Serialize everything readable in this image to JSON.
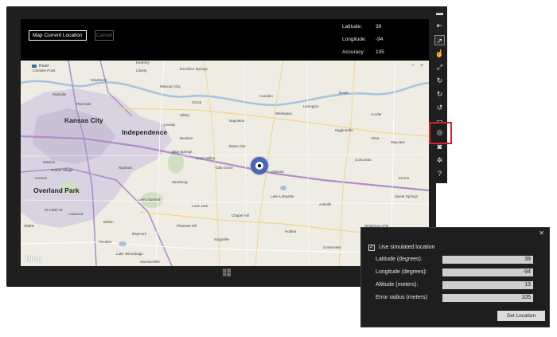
{
  "app": {
    "map_location_button": "Map Current Location",
    "cancel_button": "Cancel",
    "readouts": [
      {
        "label": "Latitude:",
        "value": "39"
      },
      {
        "label": "Longitude:",
        "value": "-94"
      },
      {
        "label": "Accuracy:",
        "value": "105"
      }
    ]
  },
  "map": {
    "road_style": "Road",
    "zoom_out": "−",
    "zoom_in": "+",
    "logo": "bing",
    "cities": {
      "kansas_city": "Kansas City",
      "independence": "Independence",
      "overland_park": "Overland Park"
    },
    "places": {
      "liberty": "Liberty",
      "gladstone": "Gladstone",
      "parkville": "Parkville",
      "riverside": "Riverside",
      "raytown": "Raytown",
      "lees_summit": "Lee's Summit",
      "blue_springs": "Blue Springs",
      "grain_valley": "Grain Valley",
      "oak_grove": "Oak Grove",
      "odessa": "Odessa",
      "lake_lafayette": "Lake Lafayette",
      "higginsville": "Higginsville",
      "alma": "Alma",
      "concordia": "Concordia",
      "lenexa": "Lenexa",
      "olathe": "Olathe",
      "leawood": "Leawood",
      "belton": "Belton",
      "raymore": "Raymore",
      "lake_winnebago": "Lake Winnebago",
      "lone_jack": "Lone Jack",
      "chapel_hill": "Chapel Hill",
      "kingsville": "Kingsville",
      "holden": "Holden",
      "centerview": "Centerview",
      "warrensburg": "Warrensburg",
      "mission": "Mission",
      "prairie_village": "Prairie Village",
      "excelsior_springs": "Excelsior Springs",
      "orrick": "Orrick",
      "camden": "Camden",
      "napoleon": "Napoleon",
      "wellington": "Wellington",
      "lexington": "Lexington",
      "dover": "Dover",
      "corder": "Corder",
      "mayview": "Mayview",
      "emma": "Emma",
      "sweet_springs": "Sweet Springs",
      "aullville": "Aullville",
      "bates_city": "Bates City",
      "buckner": "Buckner",
      "levasy": "Levasy",
      "sibley": "Sibley",
      "missouri_city": "Missouri City",
      "kearney": "Kearney",
      "camden_point": "Camden Point",
      "strasburg": "Strasburg",
      "pleasant_hill": "Pleasant Hill",
      "harrisonville": "Harrisonville",
      "peculiar": "Peculiar",
      "knob_noster": "Knob Noster",
      "whiteman": "Whiteman AFB",
      "w_135th": "W 135th St"
    }
  },
  "toolbar": {
    "tools": [
      {
        "name": "minimize-icon",
        "glyph": "▬"
      },
      {
        "name": "dock-icon",
        "glyph": "⇤"
      },
      {
        "name": "mouse-mode-icon",
        "glyph": "➚"
      },
      {
        "name": "touch-mode-icon",
        "glyph": "☝"
      },
      {
        "name": "pinch-zoom-icon",
        "glyph": "⤢"
      },
      {
        "name": "rotation-gesture-icon",
        "glyph": "↻"
      },
      {
        "name": "rotate-clockwise-icon",
        "glyph": "↻"
      },
      {
        "name": "rotate-counterclockwise-icon",
        "glyph": "↺"
      },
      {
        "name": "resolution-icon",
        "glyph": "▭"
      },
      {
        "name": "location-icon",
        "glyph": "◎"
      },
      {
        "name": "screenshot-icon",
        "glyph": "◙"
      },
      {
        "name": "settings-icon",
        "glyph": "✲"
      },
      {
        "name": "help-icon",
        "glyph": "?"
      }
    ]
  },
  "dialog": {
    "close": "✕",
    "checkbox_mark": "✓",
    "use_simulated_label": "Use simulated location",
    "rows": [
      {
        "label": "Latitude (degrees):",
        "value": "39"
      },
      {
        "label": "Longitude (degrees):",
        "value": "-94"
      },
      {
        "label": "Altitude (meters):",
        "value": "13"
      },
      {
        "label": "Error radius (meters):",
        "value": "105"
      }
    ],
    "set_button": "Set Location"
  },
  "colors": {
    "highlight": "#d8202a",
    "pin": "#4a68b2",
    "map_bg": "#eeece3",
    "urban": "#c9c2d6",
    "interstate": "#b08ec9"
  }
}
